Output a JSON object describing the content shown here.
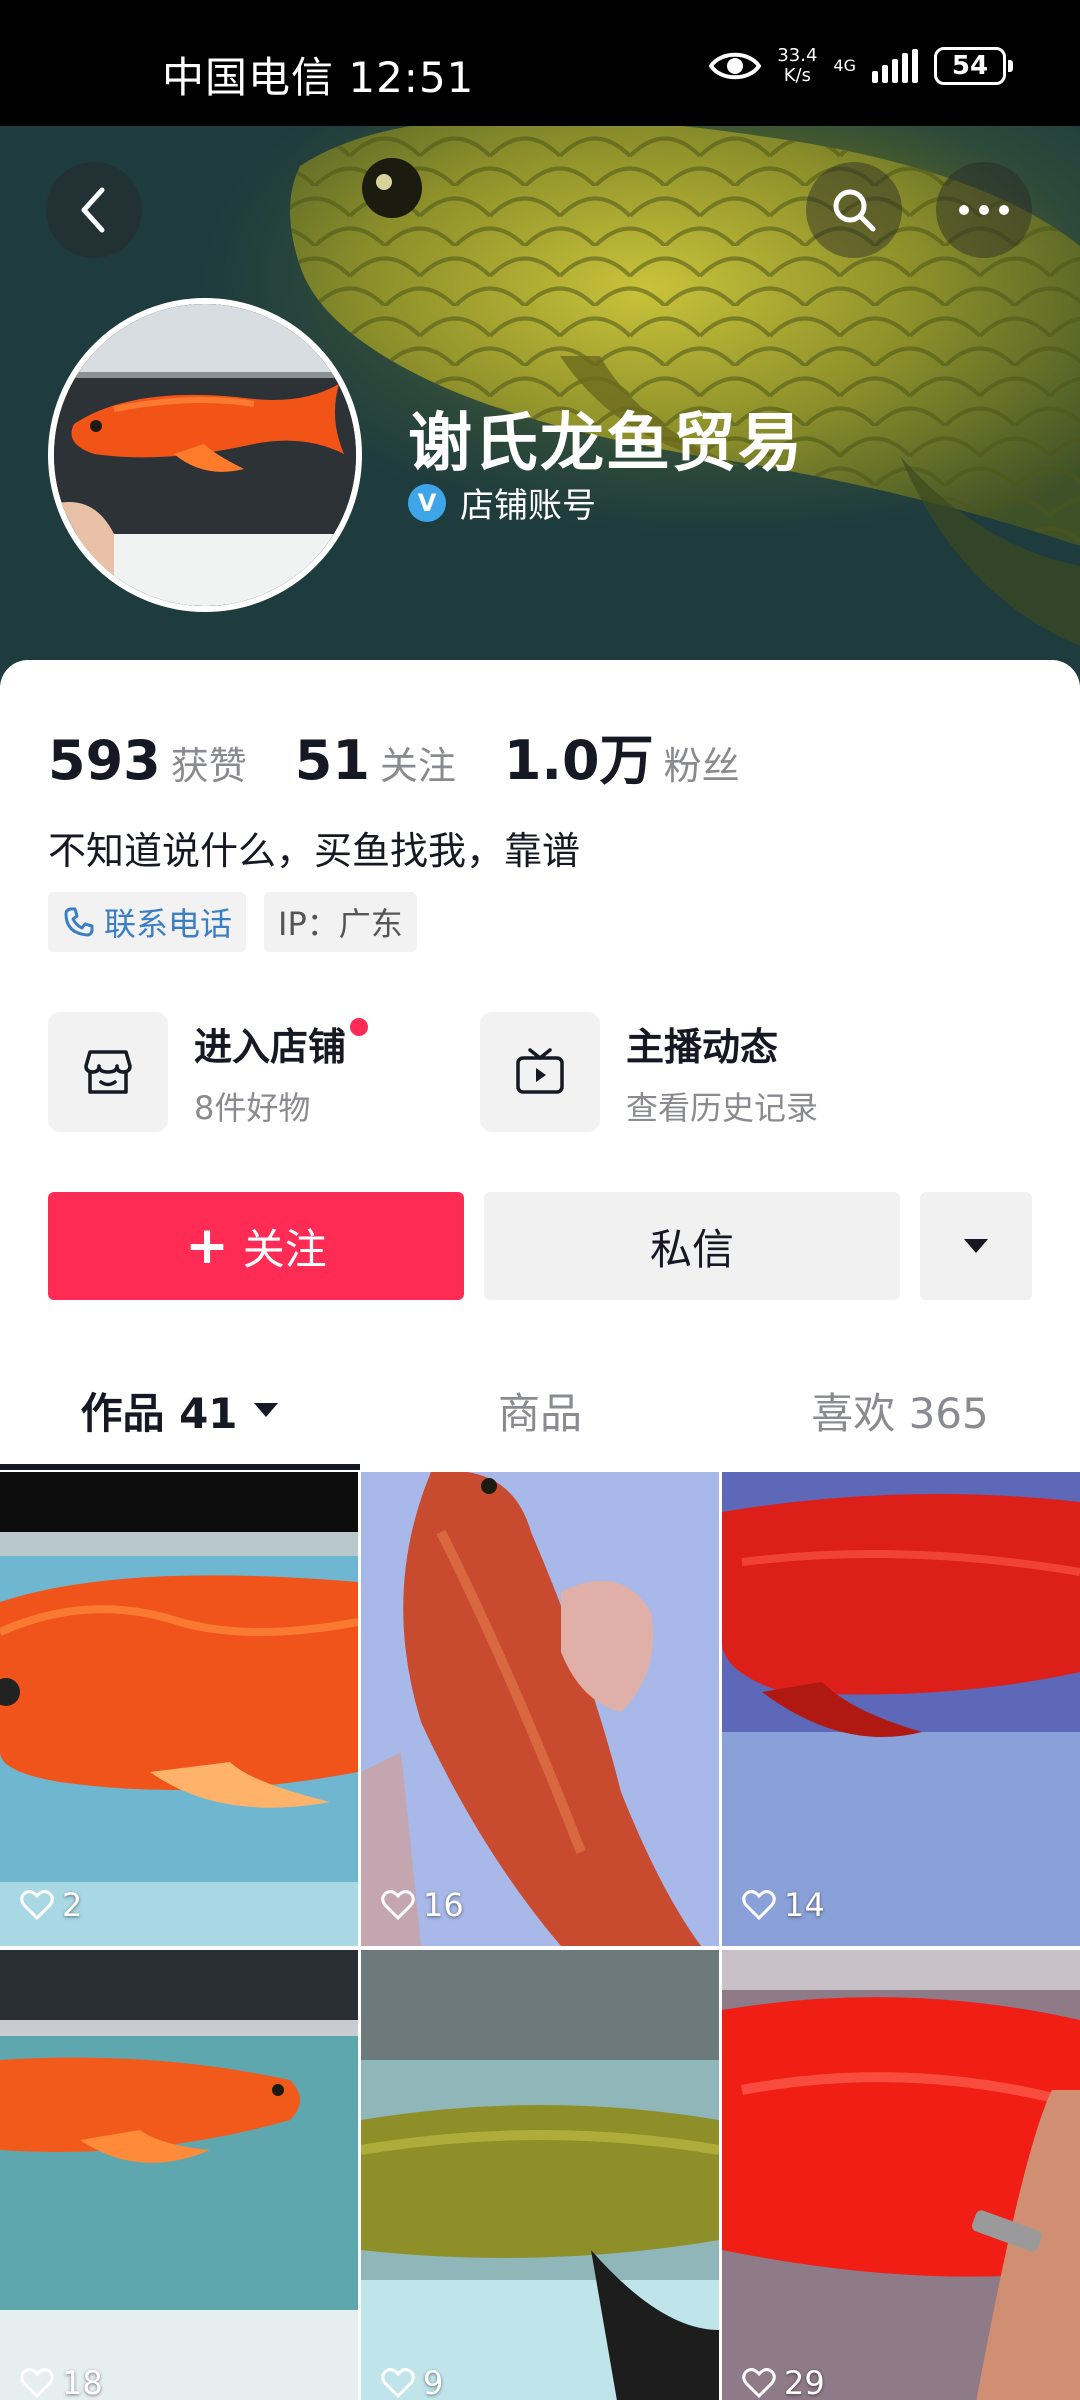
{
  "status_bar": {
    "carrier_time": "中国电信 12:51",
    "net_speed_value": "33.4",
    "net_speed_unit": "K/s",
    "network_type": "4G",
    "battery": "54"
  },
  "profile": {
    "name": "谢氏龙鱼贸易",
    "verified_label": "店铺账号",
    "bio": "不知道说什么，买鱼找我，靠谱",
    "stats": [
      {
        "value": "593",
        "label": "获赞"
      },
      {
        "value": "51",
        "label": "关注"
      },
      {
        "value": "1.0万",
        "label": "粉丝"
      }
    ],
    "tags": {
      "phone": "联系电话",
      "ip": "IP：广东"
    }
  },
  "entries": {
    "shop": {
      "title": "进入店铺",
      "subtitle": "8件好物"
    },
    "live": {
      "title": "主播动态",
      "subtitle": "查看历史记录"
    }
  },
  "actions": {
    "follow": "关注",
    "message": "私信"
  },
  "tabs": {
    "works": "作品 41",
    "products": "商品",
    "likes": "喜欢 365"
  },
  "videos": [
    {
      "likes": "2"
    },
    {
      "likes": "16"
    },
    {
      "likes": "14"
    },
    {
      "likes": "18"
    },
    {
      "likes": "9"
    },
    {
      "likes": "29"
    }
  ],
  "colors": {
    "primary": "#fe2c55",
    "verify_badge": "#3ea6e8",
    "phone_tag": "#3a7fc4"
  }
}
